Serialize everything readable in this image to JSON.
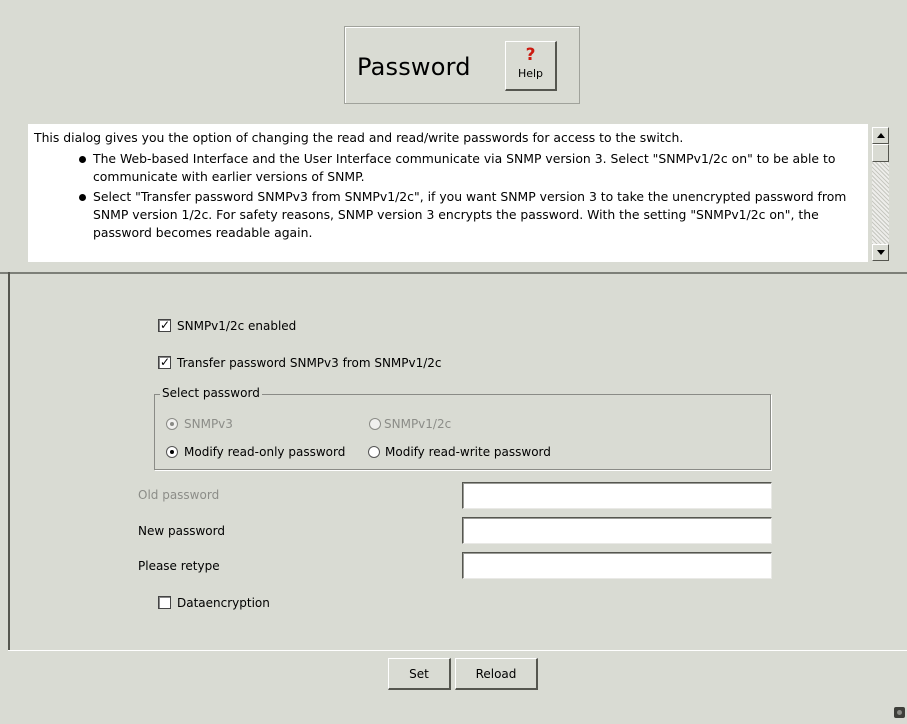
{
  "title": "Password",
  "help": {
    "glyph": "?",
    "label": "Help"
  },
  "description": {
    "intro": "This dialog gives you the option of changing the read and read/write passwords for access to the switch.",
    "bullets": [
      "The Web-based Interface and the User Interface communicate via SNMP version 3. Select \"SNMPv1/2c on\" to be able to communicate with earlier versions of SNMP.",
      "Select \"Transfer password SNMPv3 from SNMPv1/2c\", if you want SNMP version 3 to take the unencrypted password from SNMP version 1/2c. For safety reasons, SNMP version 3 encrypts the password. With the setting \"SNMPv1/2c on\", the password becomes readable again."
    ]
  },
  "form": {
    "snmp_enabled": {
      "label": "SNMPv1/2c enabled",
      "checked": true
    },
    "transfer_password": {
      "label": "Transfer password SNMPv3 from SNMPv1/2c",
      "checked": true
    },
    "select_password": {
      "legend": "Select password",
      "snmpv3": "SNMPv3",
      "snmpv12c": "SNMPv1/2c",
      "modify_read_only": "Modify read-only password",
      "modify_read_write": "Modify read-write password"
    },
    "old_password": {
      "label": "Old password",
      "value": ""
    },
    "new_password": {
      "label": "New password",
      "value": ""
    },
    "retype": {
      "label": "Please retype",
      "value": ""
    },
    "dataencryption": {
      "label": "Dataencryption",
      "checked": false
    }
  },
  "buttons": {
    "set": "Set",
    "reload": "Reload"
  },
  "colors": {
    "background": "#d9dbd3",
    "help_glyph": "#cc1a10",
    "disabled_text": "#8c8d88"
  }
}
